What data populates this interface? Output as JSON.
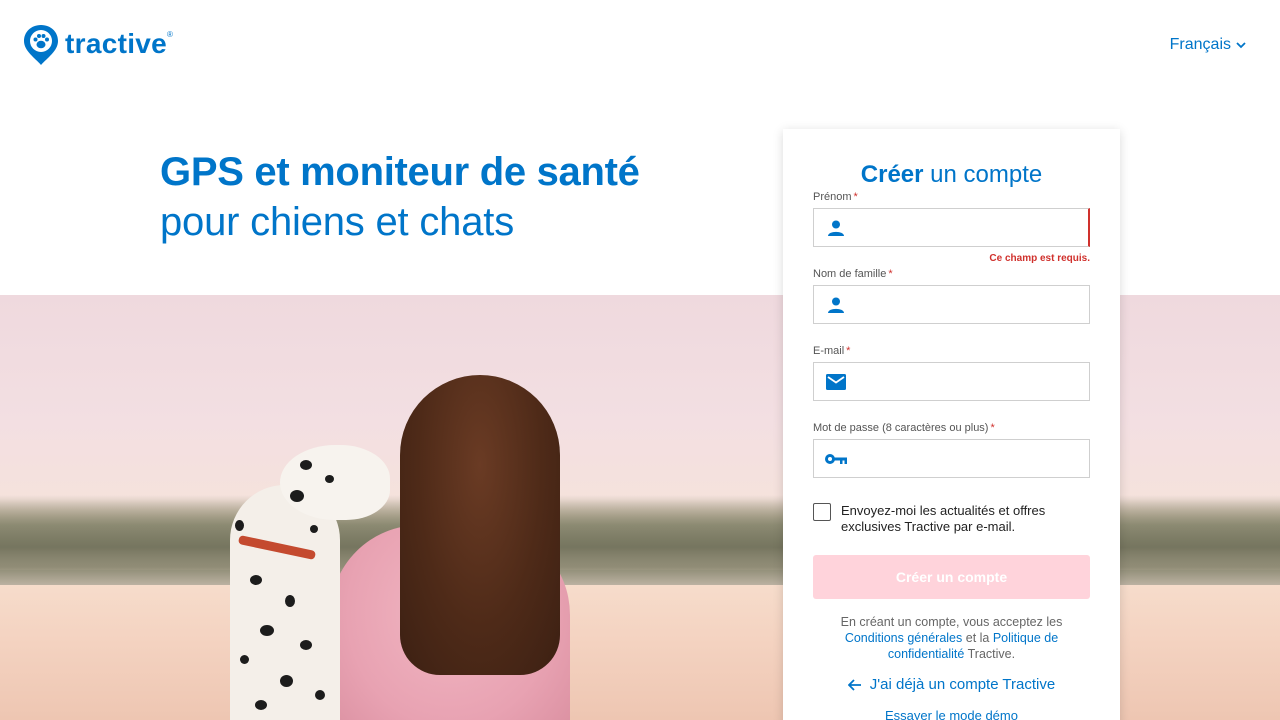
{
  "brand": {
    "name": "tractive",
    "registered": "®",
    "color": "#0075c9"
  },
  "header": {
    "language": "Français",
    "icons": {
      "logo": "paw-pin-icon",
      "language_chevron": "chevron-down-icon"
    }
  },
  "hero": {
    "title": "GPS et moniteur de santé",
    "subtitle": "pour chiens et chats"
  },
  "form": {
    "title_bold": "Créer",
    "title_rest": " un compte",
    "fields": [
      {
        "label": "Prénom",
        "required": "*",
        "icon": "person-icon",
        "value": "",
        "error": "Ce champ est requis."
      },
      {
        "label": "Nom de famille",
        "required": "*",
        "icon": "person-icon",
        "value": ""
      },
      {
        "label": "E-mail",
        "required": "*",
        "icon": "mail-icon",
        "value": ""
      },
      {
        "label": "Mot de passe (8 caractères ou plus)",
        "required": "*",
        "icon": "key-icon",
        "value": ""
      }
    ],
    "newsletter": {
      "checked": false,
      "label": "Envoyez-moi les actualités et offres exclusives Tractive par e-mail."
    },
    "submit_label": "Créer un compte",
    "terms": {
      "prefix": "En créant un compte, vous acceptez les",
      "terms_link": "Conditions générales",
      "and": " et la ",
      "privacy_link": "Politique de confidentialité",
      "suffix": " Tractive."
    },
    "login_link": "J'ai déjà un compte Tractive",
    "demo_link": "Essayer le mode démo"
  },
  "colors": {
    "accent": "#0075c9",
    "error": "#d0312d",
    "submit_disabled": "#ffd3db"
  }
}
